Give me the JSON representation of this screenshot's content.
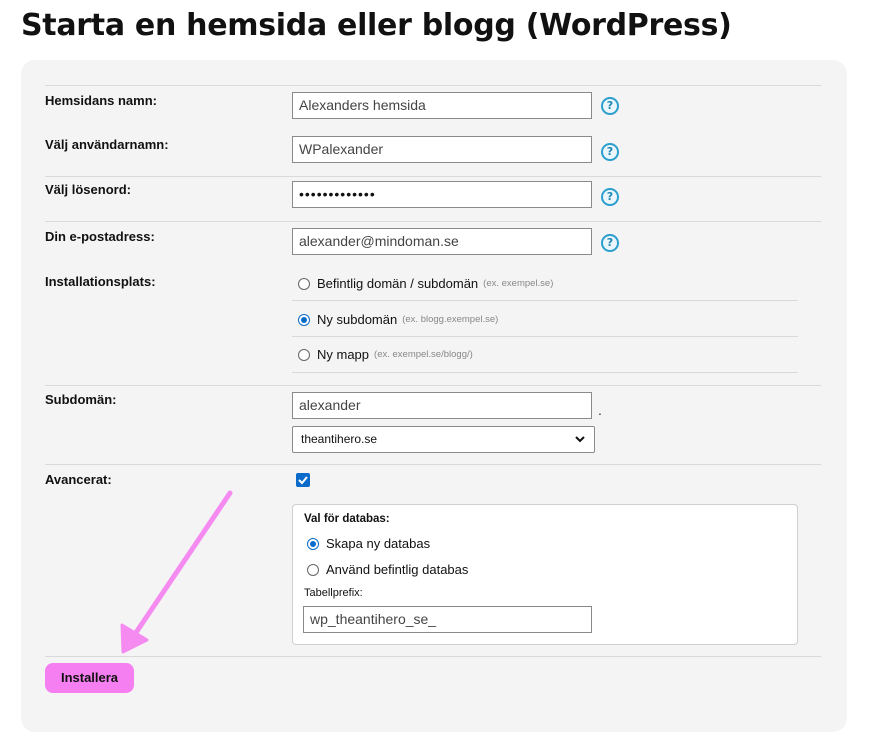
{
  "page": {
    "title": "Starta en hemsida eller blogg (WordPress)"
  },
  "form": {
    "site_name": {
      "label": "Hemsidans namn:",
      "value": "Alexanders hemsida"
    },
    "username": {
      "label": "Välj användarnamn:",
      "value": "WPalexander"
    },
    "password": {
      "label": "Välj lösenord:",
      "value": "•••••••••••••"
    },
    "email": {
      "label": "Din e-postadress:",
      "value": "alexander@mindoman.se"
    },
    "help_glyph": "?",
    "install_location": {
      "label": "Installationsplats:",
      "options": [
        {
          "label": "Befintlig domän / subdomän",
          "hint": "(ex. exempel.se)",
          "checked": false
        },
        {
          "label": "Ny subdomän",
          "hint": "(ex. blogg.exempel.se)",
          "checked": true
        },
        {
          "label": "Ny mapp",
          "hint": "(ex. exempel.se/blogg/)",
          "checked": false
        }
      ]
    },
    "subdomain": {
      "label": "Subdomän:",
      "value": "alexander",
      "separator": ".",
      "domain_selected": "theantihero.se"
    },
    "advanced": {
      "label": "Avancerat:",
      "checked": true,
      "database": {
        "legend": "Val för databas:",
        "options": [
          {
            "label": "Skapa ny databas",
            "checked": true
          },
          {
            "label": "Använd befintlig databas",
            "checked": false
          }
        ],
        "prefix_label": "Tabellprefix:",
        "prefix_value": "wp_theantihero_se_"
      }
    },
    "install_button": "Installera"
  },
  "colors": {
    "panel_bg": "#f4f4f4",
    "accent_blue": "#0b6bcb",
    "help_blue": "#2b9fce",
    "button_pink": "#f57ef0",
    "arrow_pink": "#f58bf0"
  },
  "icons": {
    "help": "question-circle-icon",
    "select": "chevron-down-icon",
    "checkbox": "checkmark-icon",
    "annotation": "arrow-icon"
  }
}
